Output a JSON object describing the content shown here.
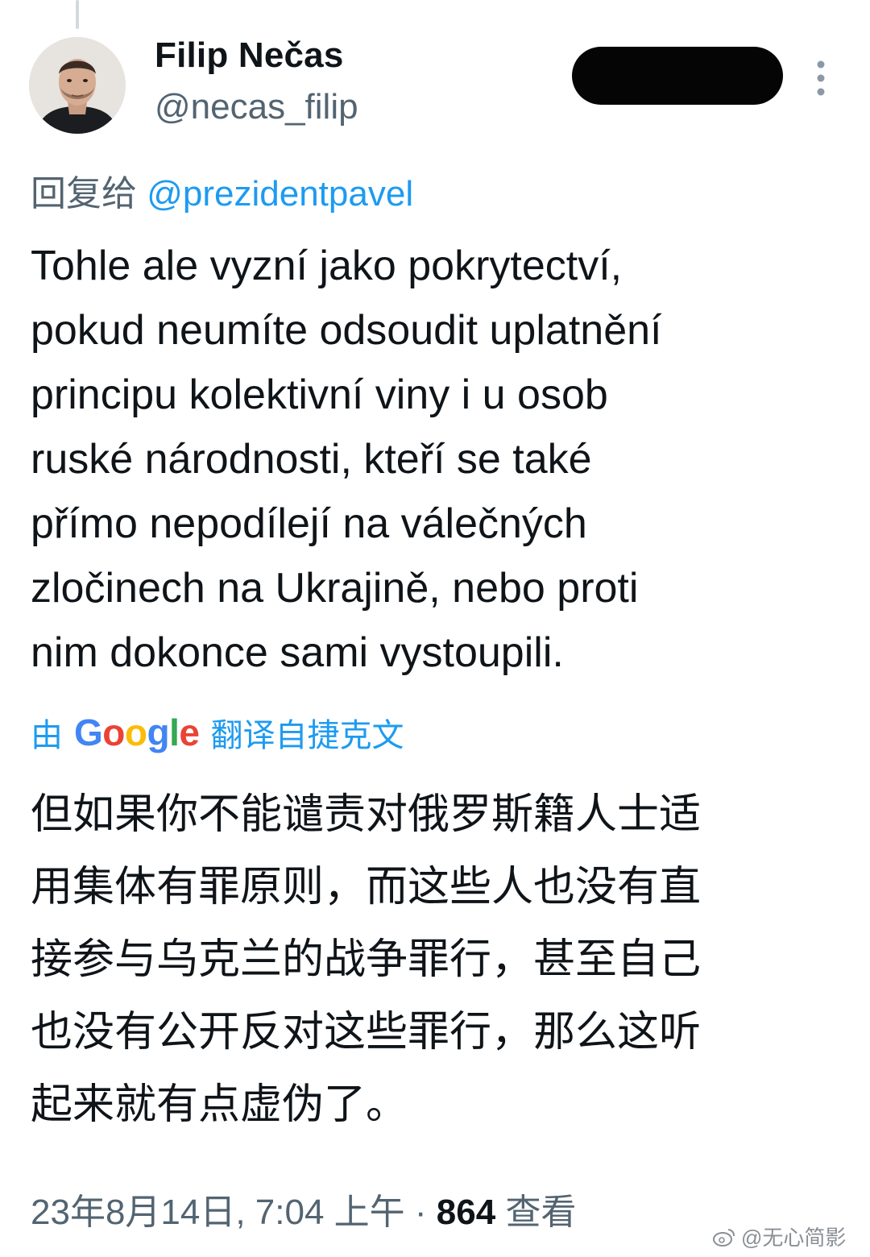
{
  "tweet": {
    "author": {
      "name": "Filip Nečas",
      "handle": "@necas_filip"
    },
    "reply_prefix": "回复给",
    "reply_to": "@prezidentpavel",
    "text": "Tohle ale vyzní jako pokrytectví,\npokud neumíte odsoudit uplatnění\nprincipu kolektivní viny i u osob\nruské národnosti, kteří se také\npřímo nepodílejí na válečných\nzločinech na Ukrajině, nebo proti\nnim dokonce sami vystoupili.",
    "translation": {
      "prefix": "由",
      "provider": "Google",
      "suffix": "翻译自捷克文",
      "text": "但如果你不能谴责对俄罗斯籍人士适\n用集体有罪原则，而这些人也没有直\n接参与乌克兰的战争罪行，甚至自己\n也没有公开反对这些罪行，那么这听\n起来就有点虚伪了。"
    },
    "meta": {
      "timestamp": "23年8月14日, 7:04 上午",
      "separator": "·",
      "views_count": "864",
      "views_label": "查看"
    }
  },
  "watermark": "@无心简影",
  "icons": {
    "more": "more-vertical-icon",
    "watermark": "weibo-icon"
  },
  "colors": {
    "link": "#1d9bf0",
    "secondary_text": "#536471",
    "primary_text": "#0f1419"
  }
}
